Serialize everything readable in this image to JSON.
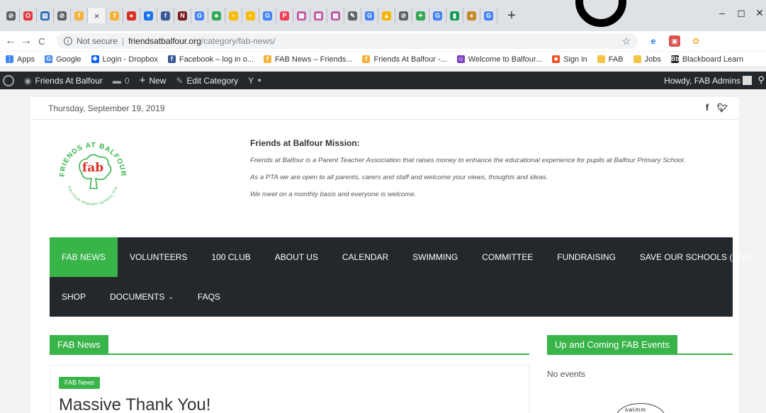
{
  "browser": {
    "tabs": [
      {
        "icon": "chrome-icon",
        "color": "#5f6368",
        "glyph": "⊘"
      },
      {
        "icon": "opera-icon",
        "color": "#e03a3e",
        "glyph": "O"
      },
      {
        "icon": "dashboard-icon",
        "color": "#2f6db5",
        "glyph": "▤"
      },
      {
        "icon": "globe-icon",
        "color": "#5f6368",
        "glyph": "⊘"
      },
      {
        "icon": "fab-favicon",
        "color": "#f6b23c",
        "glyph": "f"
      },
      {
        "icon": "fab-favicon",
        "color": "#f6b23c",
        "glyph": "f"
      },
      {
        "icon": "tomato-icon",
        "color": "#d93025",
        "glyph": "●"
      },
      {
        "icon": "mug-icon",
        "color": "#1a73e8",
        "glyph": "▾"
      },
      {
        "icon": "facebook-icon",
        "color": "#3b5998",
        "glyph": "f"
      },
      {
        "icon": "nt-icon",
        "color": "#7a1b1b",
        "glyph": "N"
      },
      {
        "icon": "google-icon",
        "color": "#4285f4",
        "glyph": "G"
      },
      {
        "icon": "leaf-icon",
        "color": "#34a853",
        "glyph": "♣"
      },
      {
        "icon": "dot-icon",
        "color": "#fbbc04",
        "glyph": "•"
      },
      {
        "icon": "dot-icon",
        "color": "#fbbc04",
        "glyph": "•"
      },
      {
        "icon": "google-icon",
        "color": "#4285f4",
        "glyph": "G"
      },
      {
        "icon": "pocket-icon",
        "color": "#ef3f56",
        "glyph": "P"
      },
      {
        "icon": "calendar-icon",
        "color": "#c0589d",
        "glyph": "▦"
      },
      {
        "icon": "calendar-icon",
        "color": "#c0589d",
        "glyph": "▦"
      },
      {
        "icon": "calendar-icon",
        "color": "#c0589d",
        "glyph": "▦"
      },
      {
        "icon": "map-icon",
        "color": "#5f6368",
        "glyph": "✎"
      },
      {
        "icon": "google-icon",
        "color": "#4285f4",
        "glyph": "G"
      },
      {
        "icon": "drive-icon",
        "color": "#f4b400",
        "glyph": "▲"
      },
      {
        "icon": "globe-icon",
        "color": "#5f6368",
        "glyph": "⊘"
      },
      {
        "icon": "maps-icon",
        "color": "#34a853",
        "glyph": "✦"
      },
      {
        "icon": "google-icon",
        "color": "#4285f4",
        "glyph": "G"
      },
      {
        "icon": "sheets-icon",
        "color": "#0f9d58",
        "glyph": "▮"
      },
      {
        "icon": "leaf-icon",
        "color": "#c58b2a",
        "glyph": "♦"
      },
      {
        "icon": "google-icon",
        "color": "#4285f4",
        "glyph": "G"
      }
    ],
    "new_tab": "+",
    "minimize": "–",
    "restore": "◻",
    "close": "✕",
    "back": "←",
    "forward": "→",
    "reload": "C",
    "not_secure": "Not secure",
    "url_host": "friendsatbalfour.org",
    "url_path": "/category/fab-news/",
    "bookmarks": [
      {
        "label": "Apps",
        "icon": "apps-icon",
        "color": "#4285f4",
        "glyph": "⋮"
      },
      {
        "label": "Google",
        "icon": "google-icon",
        "color": "#4285f4",
        "glyph": "G"
      },
      {
        "label": "Login - Dropbox",
        "icon": "dropbox-icon",
        "color": "#0061fe",
        "glyph": "❖"
      },
      {
        "label": "Facebook – log in o...",
        "icon": "facebook-icon",
        "color": "#3b5998",
        "glyph": "f"
      },
      {
        "label": "FAB News – Friends...",
        "icon": "fab-favicon",
        "color": "#f6b23c",
        "glyph": "f"
      },
      {
        "label": "Friends At Balfour -...",
        "icon": "fab-favicon",
        "color": "#f6b23c",
        "glyph": "f"
      },
      {
        "label": "Welcome to Balfour...",
        "icon": "school-icon",
        "color": "#7b3fbf",
        "glyph": "☺"
      },
      {
        "label": "Sign in",
        "icon": "microsoft-icon",
        "color": "#f25022",
        "glyph": "■"
      },
      {
        "label": "FAB",
        "icon": "folder-icon",
        "color": "#f4c542",
        "glyph": " "
      },
      {
        "label": "Jobs",
        "icon": "folder-icon",
        "color": "#f4c542",
        "glyph": " "
      },
      {
        "label": "Blackboard Learn",
        "icon": "blackboard-icon",
        "color": "#222222",
        "glyph": "Bb"
      }
    ]
  },
  "admin_bar": {
    "site_name": "Friends At Balfour",
    "comments_count": "0",
    "new_label": "New",
    "edit_label": "Edit Category",
    "howdy": "Howdy, FAB Admins"
  },
  "site": {
    "date": "Thursday, September 19, 2019",
    "logo_text": "fab",
    "logo_ring_top": "FRIENDS AT BALFOUR",
    "logo_ring_bottom": "BALFOUR PRIMARY SCHOOL PTA",
    "mission_title": "Friends at Balfour Mission:",
    "mission_lines": [
      "Friends at Balfour is a Parent Teacher Association that raises money to enhance the educational experience for pupils at Balfour Primary School.",
      "As a PTA we are open to all parents, carers and staff and welcome your views, thoughts and ideas.",
      "We meet on a monthly basis and everyone is welcome."
    ],
    "nav_row1": [
      "FAB NEWS",
      "VOLUNTEERS",
      "100 CLUB",
      "ABOUT US",
      "CALENDAR",
      "SWIMMING",
      "COMMITTEE",
      "FUNDRAISING",
      "SAVE OUR SCHOOLS (SOS)"
    ],
    "nav_row2": [
      "SHOP",
      "DOCUMENTS",
      "FAQS"
    ],
    "active_nav": "FAB NEWS",
    "accent": "#38b449"
  },
  "content": {
    "section_title": "FAB News",
    "post_badge": "FAB News",
    "post_title": "Massive Thank You!",
    "events_title": "Up and Coming FAB Events",
    "no_events": "No events",
    "widget_logo_text": "swimm"
  }
}
